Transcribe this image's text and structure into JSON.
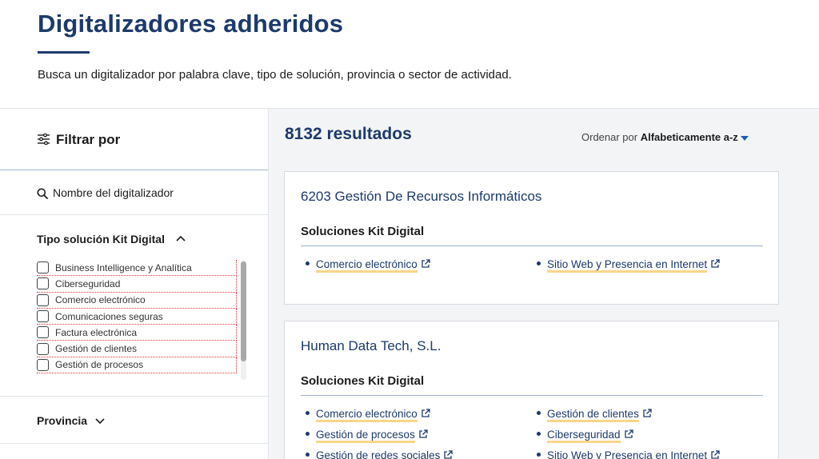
{
  "header": {
    "title": "Digitalizadores adheridos",
    "subtitle": "Busca un digitalizador por palabra clave, tipo de solución, provincia o sector de actividad."
  },
  "sidebar": {
    "filter_label": "Filtrar por",
    "name_search_label": "Nombre del digitalizador",
    "tipo_label": "Tipo solución Kit Digital",
    "tipo_options": [
      "Business Intelligence y Analítica",
      "Ciberseguridad",
      "Comercio electrónico",
      "Comunicaciones seguras",
      "Factura electrónica",
      "Gestión de clientes",
      "Gestión de procesos"
    ],
    "provincia_label": "Provincia"
  },
  "results": {
    "count_text": "8132 resultados",
    "sort_prefix": "Ordenar por",
    "sort_value": "Alfabeticamente a-z"
  },
  "cards": [
    {
      "title": "6203 Gestión De Recursos Informáticos",
      "section": "Soluciones Kit Digital",
      "left": [
        "Comercio electrónico"
      ],
      "right": [
        "Sitio Web y Presencia en Internet"
      ]
    },
    {
      "title": "Human Data Tech, S.L.",
      "section": "Soluciones Kit Digital",
      "left": [
        "Comercio electrónico",
        "Gestión de procesos",
        "Gestión de redes sociales"
      ],
      "right": [
        "Gestión de clientes",
        "Ciberseguridad",
        "Sitio Web y Presencia en Internet"
      ]
    }
  ],
  "colors": {
    "brand_blue": "#1d3a6b",
    "link_underline": "#f7d68a",
    "panel_bg": "#f3f4f6"
  }
}
